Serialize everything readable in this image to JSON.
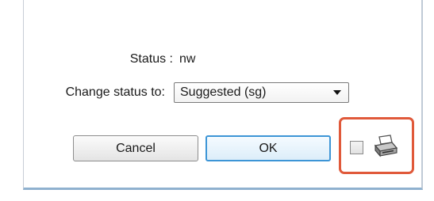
{
  "status": {
    "label": "Status :",
    "value": "nw"
  },
  "change_status": {
    "label": "Change status to:",
    "selected": "Suggested (sg)"
  },
  "buttons": {
    "cancel_label": "Cancel",
    "ok_label": "OK"
  },
  "print_option": {
    "checked": false,
    "icon": "printer-icon"
  },
  "colors": {
    "ok_border": "#3d95d6",
    "highlight": "#e0593a",
    "dialog_bottom_border": "#8fb1cf"
  }
}
